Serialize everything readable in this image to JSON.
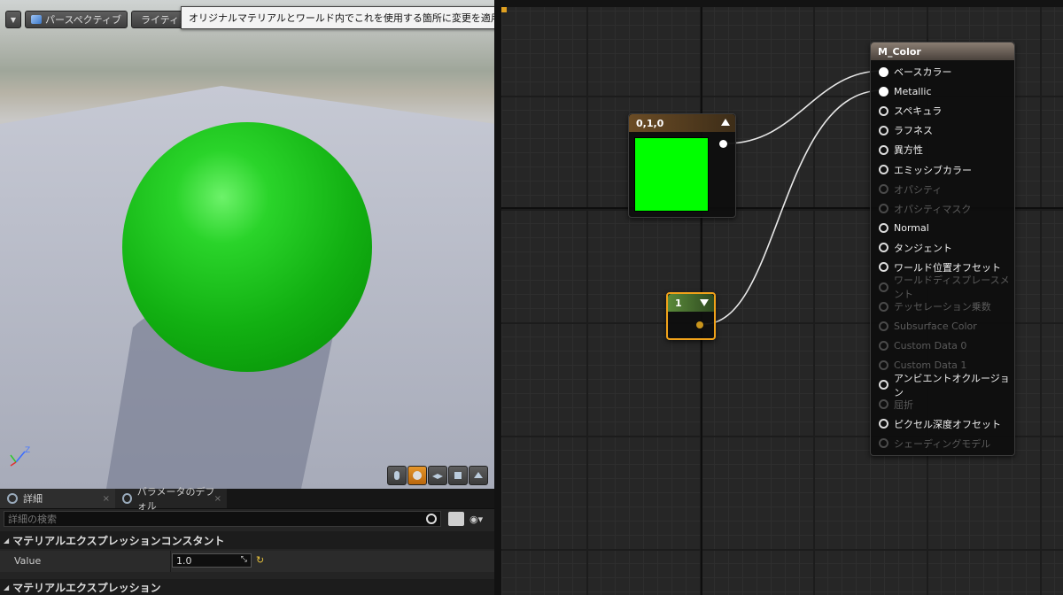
{
  "viewport": {
    "dropdown_icon": "chevron-down-icon",
    "perspective_label": "パースペクティブ",
    "lighting_label": "ライティン",
    "tooltip": "オリジナルマテリアルとワールド内でこれを使用する箇所に変更を適用",
    "axis_z": "Z",
    "preview_buttons": [
      "cylinder-icon",
      "sphere-icon",
      "plane-icon",
      "cube-icon",
      "custom-mesh-icon"
    ],
    "active_preview": "sphere-icon"
  },
  "details": {
    "tabs": [
      {
        "label": "詳細",
        "icon": "magnifier-icon"
      },
      {
        "label": "パラメータのデフォル",
        "icon": "magnifier-icon"
      }
    ],
    "tab_close": "×",
    "search_placeholder": "詳細の検索",
    "category1": "マテリアルエクスプレッションコンスタント",
    "property_label": "Value",
    "property_value": "1.0",
    "reset_icon": "↻",
    "category2": "マテリアルエクスプレッション"
  },
  "graph": {
    "const3_title": "0,1,0",
    "const3_color": "#00ff00",
    "const1_title": "1",
    "material_title": "M_Color",
    "material_inputs": [
      {
        "label": "ベースカラー",
        "enabled": true,
        "connected": true
      },
      {
        "label": "Metallic",
        "enabled": true,
        "connected": true
      },
      {
        "label": "スペキュラ",
        "enabled": true,
        "connected": false
      },
      {
        "label": "ラフネス",
        "enabled": true,
        "connected": false
      },
      {
        "label": "異方性",
        "enabled": true,
        "connected": false
      },
      {
        "label": "エミッシブカラー",
        "enabled": true,
        "connected": false
      },
      {
        "label": "オパシティ",
        "enabled": false,
        "connected": false
      },
      {
        "label": "オパシティマスク",
        "enabled": false,
        "connected": false
      },
      {
        "label": "Normal",
        "enabled": true,
        "connected": false
      },
      {
        "label": "タンジェント",
        "enabled": true,
        "connected": false
      },
      {
        "label": "ワールド位置オフセット",
        "enabled": true,
        "connected": false
      },
      {
        "label": "ワールドディスプレースメント",
        "enabled": false,
        "connected": false
      },
      {
        "label": "テッセレーション乗数",
        "enabled": false,
        "connected": false
      },
      {
        "label": "Subsurface Color",
        "enabled": false,
        "connected": false
      },
      {
        "label": "Custom Data 0",
        "enabled": false,
        "connected": false
      },
      {
        "label": "Custom Data 1",
        "enabled": false,
        "connected": false
      },
      {
        "label": "アンビエントオクルージョン",
        "enabled": true,
        "connected": false
      },
      {
        "label": "屈折",
        "enabled": false,
        "connected": false
      },
      {
        "label": "ピクセル深度オフセット",
        "enabled": true,
        "connected": false
      },
      {
        "label": "シェーディングモデル",
        "enabled": false,
        "connected": false
      }
    ],
    "accent": "#f0a21a"
  }
}
